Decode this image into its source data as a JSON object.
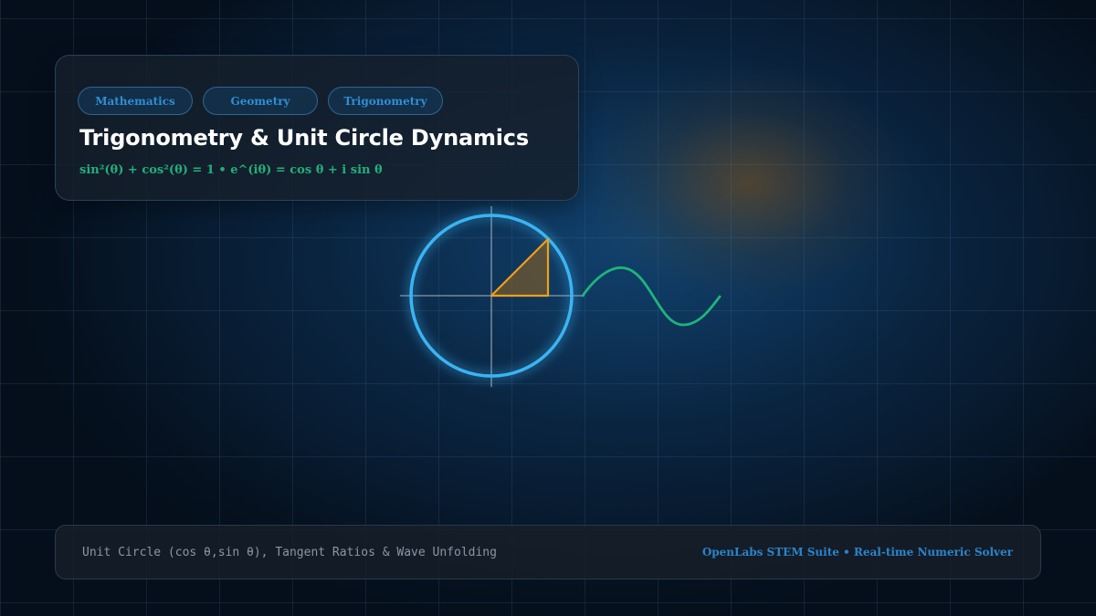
{
  "header": {
    "tags": [
      "Mathematics",
      "Geometry",
      "Trigonometry"
    ],
    "title": "Trigonometry & Unit Circle Dynamics",
    "formula": "sin²(θ) + cos²(θ) = 1 • e^(iθ) = cos θ + i sin θ"
  },
  "footer": {
    "description": "Unit Circle (cos θ,sin θ), Tangent Ratios & Wave Unfolding",
    "credit": "OpenLabs STEM Suite • Real-time Numeric Solver"
  },
  "colors": {
    "circle": "#3bb4f2",
    "triangle": "#f0a018",
    "wave": "#1fb37c",
    "axes": "#b4bcc6"
  },
  "icons": [
    "unit-circle-diagram"
  ]
}
